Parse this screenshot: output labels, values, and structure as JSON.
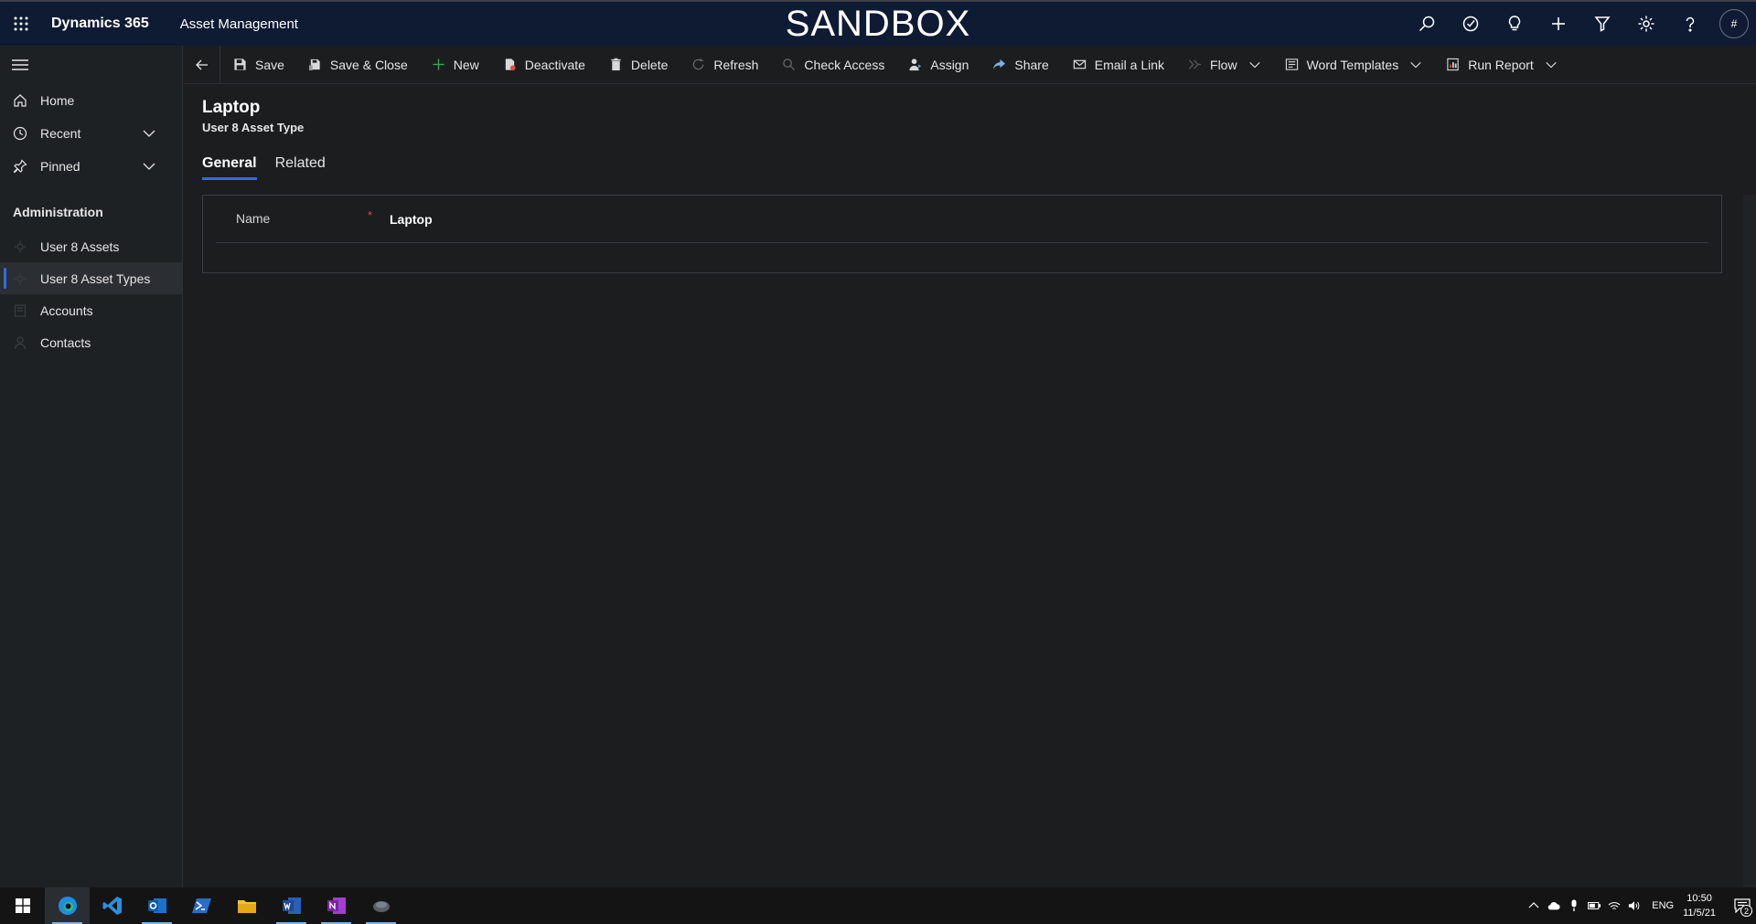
{
  "topbar": {
    "brand": "Dynamics 365",
    "app_name": "Asset Management",
    "environment_banner": "SANDBOX",
    "avatar_initials": "#",
    "icons": [
      "search-icon",
      "task-icon",
      "lightbulb-icon",
      "plus-icon",
      "filter-icon",
      "gear-icon",
      "help-icon"
    ]
  },
  "sidebar": {
    "items": [
      {
        "label": "Home",
        "icon": "home-icon"
      },
      {
        "label": "Recent",
        "icon": "clock-icon"
      },
      {
        "label": "Pinned",
        "icon": "pin-icon"
      }
    ],
    "section_title": "Administration",
    "entities": [
      {
        "label": "User 8 Assets"
      },
      {
        "label": "User 8 Asset Types",
        "selected": true
      },
      {
        "label": "Accounts"
      },
      {
        "label": "Contacts"
      }
    ]
  },
  "commands": {
    "save": "Save",
    "save_close": "Save & Close",
    "new": "New",
    "deactivate": "Deactivate",
    "delete": "Delete",
    "refresh": "Refresh",
    "check_access": "Check Access",
    "assign": "Assign",
    "share": "Share",
    "email_link": "Email a Link",
    "flow": "Flow",
    "word_templates": "Word Templates",
    "run_report": "Run Report"
  },
  "record": {
    "title": "Laptop",
    "entity_type": "User 8 Asset Type"
  },
  "tabs": {
    "general": "General",
    "related": "Related"
  },
  "form": {
    "name_label": "Name",
    "required_marker": "*",
    "name_value": "Laptop"
  },
  "taskbar": {
    "apps": [
      "windows-start",
      "edge-icon",
      "vscode-icon",
      "outlook-icon",
      "powershell-icon",
      "file-explorer-icon",
      "word-icon",
      "onenote-icon",
      "mouse-app-icon"
    ],
    "language": "ENG",
    "time": "10:50",
    "date": "11/5/21",
    "notification_count": "2"
  },
  "colors": {
    "accent": "#2f6fde",
    "topbar": "#0f1b33",
    "background": "#1b1d1f",
    "required": "#e04a4a"
  }
}
